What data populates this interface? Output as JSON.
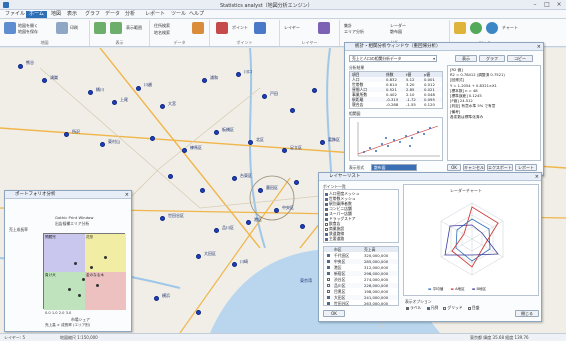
{
  "window": {
    "title": "Statistics analyst（地図分析エンジン）"
  },
  "menu": {
    "items": [
      "ファイル",
      "ホーム",
      "地図",
      "表示",
      "グラフ",
      "データ",
      "分析",
      "レポート",
      "ツール",
      "ヘルプ"
    ],
    "active_index": 1
  },
  "ribbon": {
    "groups": [
      "地図",
      "表示",
      "データ",
      "ポイント",
      "レイヤー",
      "分析",
      "ツール"
    ],
    "labels": [
      "地図を開く",
      "地図を保存",
      "印刷",
      "表示範囲",
      "拡大",
      "縮小",
      "住所検索",
      "地名検索",
      "ポイント",
      "レイヤー",
      "集計",
      "エリア分析",
      "レーダー",
      "散布図",
      "チャート"
    ]
  },
  "map": {
    "places": [
      "熊谷",
      "鴻巣",
      "桶川",
      "上尾",
      "川越",
      "大宮",
      "浦和",
      "川口",
      "戸田",
      "所沢",
      "東村山",
      "小平",
      "立川",
      "国分寺",
      "府中",
      "調布",
      "練馬区",
      "板橋区",
      "北区",
      "足立区",
      "葛飾区",
      "江戸川区",
      "荒川区",
      "台東区",
      "墨田区",
      "江東区",
      "中央区",
      "千代田区",
      "港区",
      "品川区",
      "目黒区",
      "世田谷区",
      "大田区",
      "川崎",
      "横浜",
      "松戸",
      "市川",
      "船橋",
      "柏",
      "我孫子",
      "流山",
      "草加",
      "越谷",
      "春日部",
      "三郷",
      "八潮",
      "浦安",
      "習志野",
      "千葉",
      "木更津",
      "東京湾"
    ]
  },
  "matrix_panel": {
    "title": "ポートフォリオ分析",
    "header": "Gothic Print Window",
    "subtitle": "出店候補エリア分析",
    "yaxis": "売上成長率",
    "xaxis": "市場シェア",
    "quadrants": [
      "問題児",
      "花形",
      "負け犬",
      "金のなる木"
    ],
    "xrange_label": "0.0 1.0 2.0 3.0",
    "foot": "売上高 × 成長率 (エリア別)"
  },
  "stats_panel": {
    "title": "統計・相関分析ウィンドウ（重回帰分析）",
    "tab_labels": [
      "表示",
      "グラフ",
      "コピー"
    ],
    "dropdown": "売上と人口の相関分析データ",
    "section": "分析結果",
    "table_headers": [
      "項目",
      "係数",
      "t値",
      "p値"
    ],
    "rows": [
      [
        "人口",
        "0.832",
        "5.12",
        "0.001"
      ],
      [
        "世帯数",
        "0.614",
        "3.20",
        "0.012"
      ],
      [
        "昼間人口",
        "0.521",
        "2.85",
        "0.021"
      ],
      [
        "事業所数",
        "0.402",
        "2.10",
        "0.048"
      ],
      [
        "駅距離",
        "-0.315",
        "-1.72",
        "0.095"
      ],
      [
        "競合店",
        "-0.288",
        "-1.55",
        "0.120"
      ]
    ],
    "result_lines": [
      "[R2 値]",
      "R2 = 0.78412 (調整済 0.7521)",
      "[回帰式]",
      "Y = 1.2054 + 0.8321×X1",
      "[標本数]  n = 48",
      "[標準誤差] 0.1245",
      "[F値] 24.512",
      "[判定] 有意水準 5% で有意",
      "[備考]",
      "各変数は標準化済み"
    ],
    "scatter_title": "相関図",
    "footer_label": "表示形式",
    "footer_select": "散布図",
    "buttons": [
      "OK",
      "キャンセル",
      "エクスポート",
      "CSV",
      "レポート"
    ]
  },
  "layer_panel": {
    "title": "レイヤーリスト",
    "col_header": "ポイント一覧",
    "layers": [
      "人口密度メッシュ",
      "世帯数メッシュ",
      "駅別乗降者数",
      "コンビニ店舗",
      "スーパー店舗",
      "ドラッグストア",
      "飲食店",
      "商業施設",
      "鉄道路線",
      "主要道路"
    ],
    "grid_headers": [
      "",
      "市区",
      "売上高"
    ],
    "grid_rows": [
      [
        "千代田区",
        "320,000,000"
      ],
      [
        "中央区",
        "285,000,000"
      ],
      [
        "港区",
        "312,000,000"
      ],
      [
        "新宿区",
        "298,000,000"
      ],
      [
        "渋谷区",
        "274,000,000"
      ],
      [
        "品川区",
        "226,000,000"
      ],
      [
        "目黒区",
        "198,000,000"
      ],
      [
        "大田区",
        "241,000,000"
      ],
      [
        "世田谷区",
        "263,000,000"
      ]
    ],
    "radar_title": "レーダーチャート",
    "radar_legend": [
      "平均値",
      "A地区",
      "B地区"
    ],
    "options_label": "表示オプション",
    "options": [
      "ラベル",
      "凡例",
      "グリッド",
      "目盛"
    ],
    "buttons": [
      "OK",
      "閉じる"
    ]
  },
  "status": {
    "left": "レイヤー: 5",
    "mid": "地図縮尺 1:150,000",
    "right": "東京都 緯度 35.68 経度 139.76"
  },
  "colors": {
    "accent": "#2f6fb5",
    "dot": "#1f3fbf",
    "water": "#b9d6ee",
    "road": "#f0b64a"
  }
}
